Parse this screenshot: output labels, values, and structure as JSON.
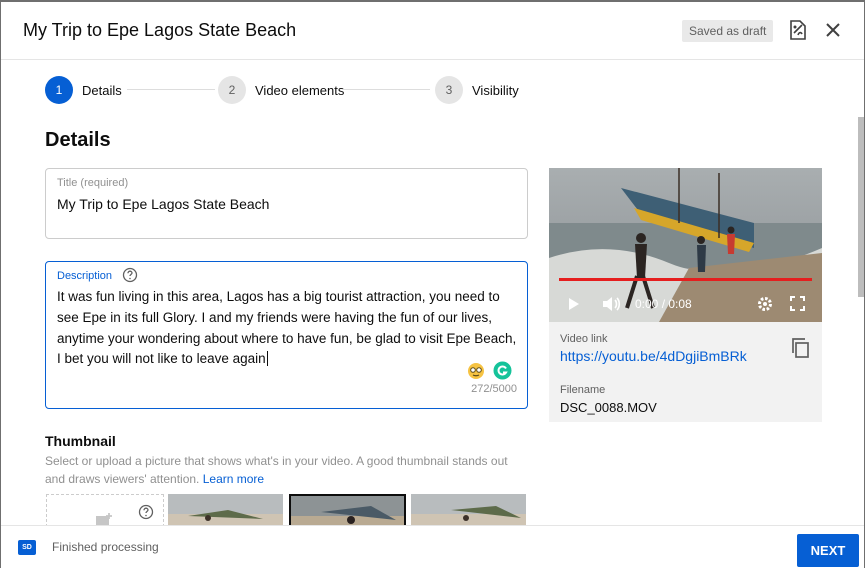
{
  "header": {
    "title": "My Trip to Epe Lagos State Beach",
    "draft_badge": "Saved as draft"
  },
  "stepper": {
    "steps": [
      {
        "number": "1",
        "label": "Details"
      },
      {
        "number": "2",
        "label": "Video elements"
      },
      {
        "number": "3",
        "label": "Visibility"
      }
    ]
  },
  "main": {
    "section_title": "Details",
    "title_field": {
      "label": "Title (required)",
      "value": "My Trip to Epe Lagos State Beach"
    },
    "description_field": {
      "label": "Description",
      "lines": [
        "It was fun living in this area, Lagos has a big tourist attraction, you need to",
        "see Epe in its full Glory. I and my friends were having the fun of our lives,",
        "anytime your wondering about where to have fun, be glad to visit Epe Beach,",
        "I bet you will not like to leave again"
      ],
      "counter": "272/5000"
    },
    "thumbnail": {
      "title": "Thumbnail",
      "description": "Select or upload a picture that shows what's in your video. A good thumbnail stands out and draws viewers' attention.",
      "link": "Learn more"
    }
  },
  "video_card": {
    "time": "0:00 / 0:08",
    "link_label": "Video link",
    "link": "https://youtu.be/4dDgjiBmBRk",
    "filename_label": "Filename",
    "filename": "DSC_0088.MOV"
  },
  "footer": {
    "badge": "SD",
    "status": "Finished processing",
    "next_label": "NEXT"
  },
  "colors": {
    "accent": "#065fd4",
    "progress_red": "#e51e1e"
  }
}
